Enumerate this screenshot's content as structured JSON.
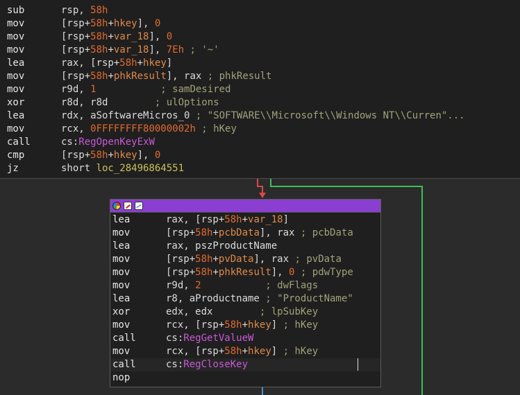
{
  "top_block": {
    "lines": [
      {
        "mnemonic": "sub",
        "operands": [
          {
            "t": "rsp, ",
            "c": "plain"
          },
          {
            "t": "58h",
            "c": "num"
          }
        ]
      },
      {
        "mnemonic": "mov",
        "operands": [
          {
            "t": "[rsp+",
            "c": "plain"
          },
          {
            "t": "58h",
            "c": "num"
          },
          {
            "t": "+",
            "c": "plain"
          },
          {
            "t": "hkey",
            "c": "var"
          },
          {
            "t": "], ",
            "c": "plain"
          },
          {
            "t": "0",
            "c": "num"
          }
        ]
      },
      {
        "mnemonic": "mov",
        "operands": [
          {
            "t": "[rsp+",
            "c": "plain"
          },
          {
            "t": "58h",
            "c": "num"
          },
          {
            "t": "+",
            "c": "plain"
          },
          {
            "t": "var_18",
            "c": "var"
          },
          {
            "t": "], ",
            "c": "plain"
          },
          {
            "t": "0",
            "c": "num"
          }
        ]
      },
      {
        "mnemonic": "mov",
        "operands": [
          {
            "t": "[rsp+",
            "c": "plain"
          },
          {
            "t": "58h",
            "c": "num"
          },
          {
            "t": "+",
            "c": "plain"
          },
          {
            "t": "var_18",
            "c": "var"
          },
          {
            "t": "], ",
            "c": "plain"
          },
          {
            "t": "7Eh",
            "c": "num"
          },
          {
            "t": " ; '~'",
            "c": "cmt"
          }
        ]
      },
      {
        "mnemonic": "lea",
        "operands": [
          {
            "t": "rax, [rsp+",
            "c": "plain"
          },
          {
            "t": "58h",
            "c": "num"
          },
          {
            "t": "+",
            "c": "plain"
          },
          {
            "t": "hkey",
            "c": "var"
          },
          {
            "t": "]",
            "c": "plain"
          }
        ]
      },
      {
        "mnemonic": "mov",
        "operands": [
          {
            "t": "[rsp+",
            "c": "plain"
          },
          {
            "t": "58h",
            "c": "num"
          },
          {
            "t": "+",
            "c": "plain"
          },
          {
            "t": "phkResult",
            "c": "var"
          },
          {
            "t": "], rax",
            "c": "plain"
          },
          {
            "t": " ; phkResult",
            "c": "cmt"
          }
        ]
      },
      {
        "mnemonic": "mov",
        "operands": [
          {
            "t": "r9d, ",
            "c": "plain"
          },
          {
            "t": "1",
            "c": "num"
          },
          {
            "t": "           ; samDesired",
            "c": "cmt"
          }
        ]
      },
      {
        "mnemonic": "xor",
        "operands": [
          {
            "t": "r8d, r8d",
            "c": "plain"
          },
          {
            "t": "        ; ulOptions",
            "c": "cmt"
          }
        ]
      },
      {
        "mnemonic": "lea",
        "operands": [
          {
            "t": "rdx, aSoftwareMicros_0",
            "c": "plain"
          },
          {
            "t": " ; \"SOFTWARE\\\\Microsoft\\\\Windows NT\\\\Curren\"...",
            "c": "cmt"
          }
        ]
      },
      {
        "mnemonic": "mov",
        "operands": [
          {
            "t": "rcx, ",
            "c": "plain"
          },
          {
            "t": "0FFFFFFFF80000002h",
            "c": "num"
          },
          {
            "t": " ; hKey",
            "c": "cmt"
          }
        ]
      },
      {
        "mnemonic": "call",
        "operands": [
          {
            "t": "cs:",
            "c": "plain"
          },
          {
            "t": "RegOpenKeyExW",
            "c": "api"
          }
        ]
      },
      {
        "mnemonic": "cmp",
        "operands": [
          {
            "t": "[rsp+",
            "c": "plain"
          },
          {
            "t": "58h",
            "c": "num"
          },
          {
            "t": "+",
            "c": "plain"
          },
          {
            "t": "hkey",
            "c": "var"
          },
          {
            "t": "], ",
            "c": "plain"
          },
          {
            "t": "0",
            "c": "num"
          }
        ]
      },
      {
        "mnemonic": "jz",
        "operands": [
          {
            "t": "short ",
            "c": "plain"
          },
          {
            "t": "loc_28496864551",
            "c": "loc"
          }
        ]
      }
    ]
  },
  "bottom_block": {
    "titlebar_icons": [
      "color-palette-icon",
      "rename-icon",
      "graph-icon"
    ],
    "lines": [
      {
        "mnemonic": "lea",
        "operands": [
          {
            "t": "rax, [rsp+",
            "c": "plain"
          },
          {
            "t": "58h",
            "c": "num"
          },
          {
            "t": "+",
            "c": "plain"
          },
          {
            "t": "var_18",
            "c": "var"
          },
          {
            "t": "]",
            "c": "plain"
          }
        ]
      },
      {
        "mnemonic": "mov",
        "operands": [
          {
            "t": "[rsp+",
            "c": "plain"
          },
          {
            "t": "58h",
            "c": "num"
          },
          {
            "t": "+",
            "c": "plain"
          },
          {
            "t": "pcbData",
            "c": "var"
          },
          {
            "t": "], rax",
            "c": "plain"
          },
          {
            "t": " ; pcbData",
            "c": "cmt"
          }
        ]
      },
      {
        "mnemonic": "lea",
        "operands": [
          {
            "t": "rax, pszProductName",
            "c": "plain"
          }
        ]
      },
      {
        "mnemonic": "mov",
        "operands": [
          {
            "t": "[rsp+",
            "c": "plain"
          },
          {
            "t": "58h",
            "c": "num"
          },
          {
            "t": "+",
            "c": "plain"
          },
          {
            "t": "pvData",
            "c": "var"
          },
          {
            "t": "], rax",
            "c": "plain"
          },
          {
            "t": " ; pvData",
            "c": "cmt"
          }
        ]
      },
      {
        "mnemonic": "mov",
        "operands": [
          {
            "t": "[rsp+",
            "c": "plain"
          },
          {
            "t": "58h",
            "c": "num"
          },
          {
            "t": "+",
            "c": "plain"
          },
          {
            "t": "phkResult",
            "c": "var"
          },
          {
            "t": "], ",
            "c": "plain"
          },
          {
            "t": "0",
            "c": "num"
          },
          {
            "t": " ; pdwType",
            "c": "cmt"
          }
        ]
      },
      {
        "mnemonic": "mov",
        "operands": [
          {
            "t": "r9d, ",
            "c": "plain"
          },
          {
            "t": "2",
            "c": "num"
          },
          {
            "t": "           ; dwFlags",
            "c": "cmt"
          }
        ]
      },
      {
        "mnemonic": "lea",
        "operands": [
          {
            "t": "r8, aProductname",
            "c": "plain"
          },
          {
            "t": " ; \"ProductName\"",
            "c": "cmt"
          }
        ]
      },
      {
        "mnemonic": "xor",
        "operands": [
          {
            "t": "edx, edx",
            "c": "plain"
          },
          {
            "t": "        ; lpSubKey",
            "c": "cmt"
          }
        ]
      },
      {
        "mnemonic": "mov",
        "operands": [
          {
            "t": "rcx, [rsp+",
            "c": "plain"
          },
          {
            "t": "58h",
            "c": "num"
          },
          {
            "t": "+",
            "c": "plain"
          },
          {
            "t": "hkey",
            "c": "var"
          },
          {
            "t": "]",
            "c": "plain"
          },
          {
            "t": " ; hKey",
            "c": "cmt"
          }
        ]
      },
      {
        "mnemonic": "call",
        "operands": [
          {
            "t": "cs:",
            "c": "plain"
          },
          {
            "t": "RegGetValueW",
            "c": "api"
          }
        ]
      },
      {
        "mnemonic": "mov",
        "operands": [
          {
            "t": "rcx, [rsp+",
            "c": "plain"
          },
          {
            "t": "58h",
            "c": "num"
          },
          {
            "t": "+",
            "c": "plain"
          },
          {
            "t": "hkey",
            "c": "var"
          },
          {
            "t": "]",
            "c": "plain"
          },
          {
            "t": " ; hKey",
            "c": "cmt"
          }
        ]
      },
      {
        "mnemonic": "call",
        "operands": [
          {
            "t": "cs:",
            "c": "plain"
          },
          {
            "t": "RegCloseKey",
            "c": "api"
          }
        ]
      },
      {
        "mnemonic": "nop",
        "operands": []
      }
    ]
  },
  "colors": {
    "background": "#2b2b2b",
    "block_background": "#1f1f1f",
    "titlebar": "#8a3fd1",
    "edge_false": "#d94848",
    "edge_true": "#3fbf5f",
    "edge_next": "#4a8fd8"
  }
}
